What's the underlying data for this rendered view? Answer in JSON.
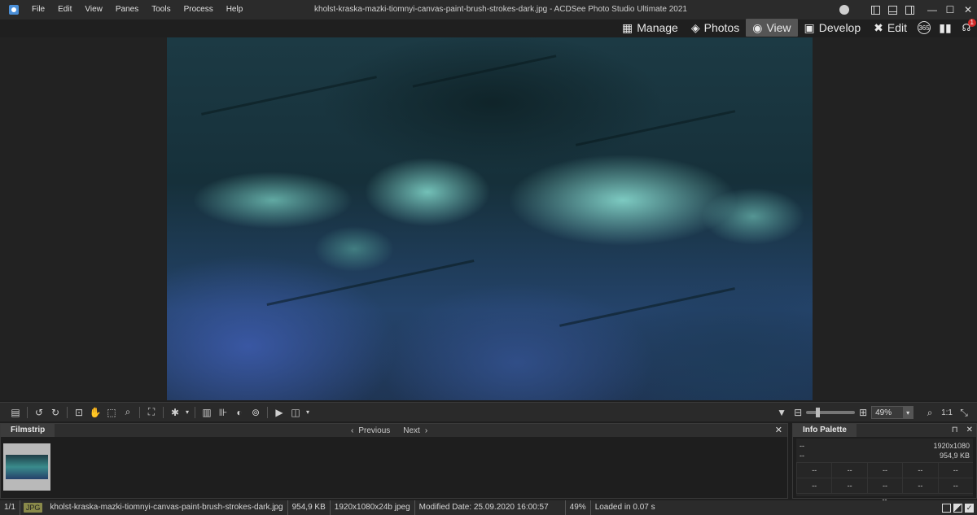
{
  "window": {
    "title": "kholst-kraska-mazki-tiomnyi-canvas-paint-brush-strokes-dark.jpg - ACDSee Photo Studio Ultimate 2021"
  },
  "menu": [
    "File",
    "Edit",
    "View",
    "Panes",
    "Tools",
    "Process",
    "Help"
  ],
  "window_controls": {
    "minimize": "—",
    "maximize": "☐",
    "close": "✕"
  },
  "modes": {
    "manage": "Manage",
    "photos": "Photos",
    "view": "View",
    "develop": "Develop",
    "edit": "Edit",
    "badge_365": "365",
    "notifications_count": "1"
  },
  "toolbar": {
    "zoom_value": "49%",
    "ratio_label": "1:1"
  },
  "filmstrip": {
    "title": "Filmstrip",
    "previous": "Previous",
    "next": "Next",
    "close": "✕"
  },
  "info_palette": {
    "title": "Info Palette",
    "pin": "⊓",
    "close": "✕",
    "dims_left": "--",
    "dims": "1920x1080",
    "size_left": "--",
    "size": "954,9 KB",
    "grid": [
      "--",
      "--",
      "--",
      "--",
      "--",
      "--",
      "--",
      "--",
      "--",
      "--"
    ],
    "last": "--"
  },
  "status": {
    "index": "1/1",
    "format": "JPG",
    "filename": "kholst-kraska-mazki-tiomnyi-canvas-paint-brush-strokes-dark.jpg",
    "filesize": "954,9 KB",
    "dimensions": "1920x1080x24b jpeg",
    "modified": "Modified Date: 25.09.2020 16:00:57",
    "zoom": "49%",
    "loaded": "Loaded in 0.07 s"
  }
}
